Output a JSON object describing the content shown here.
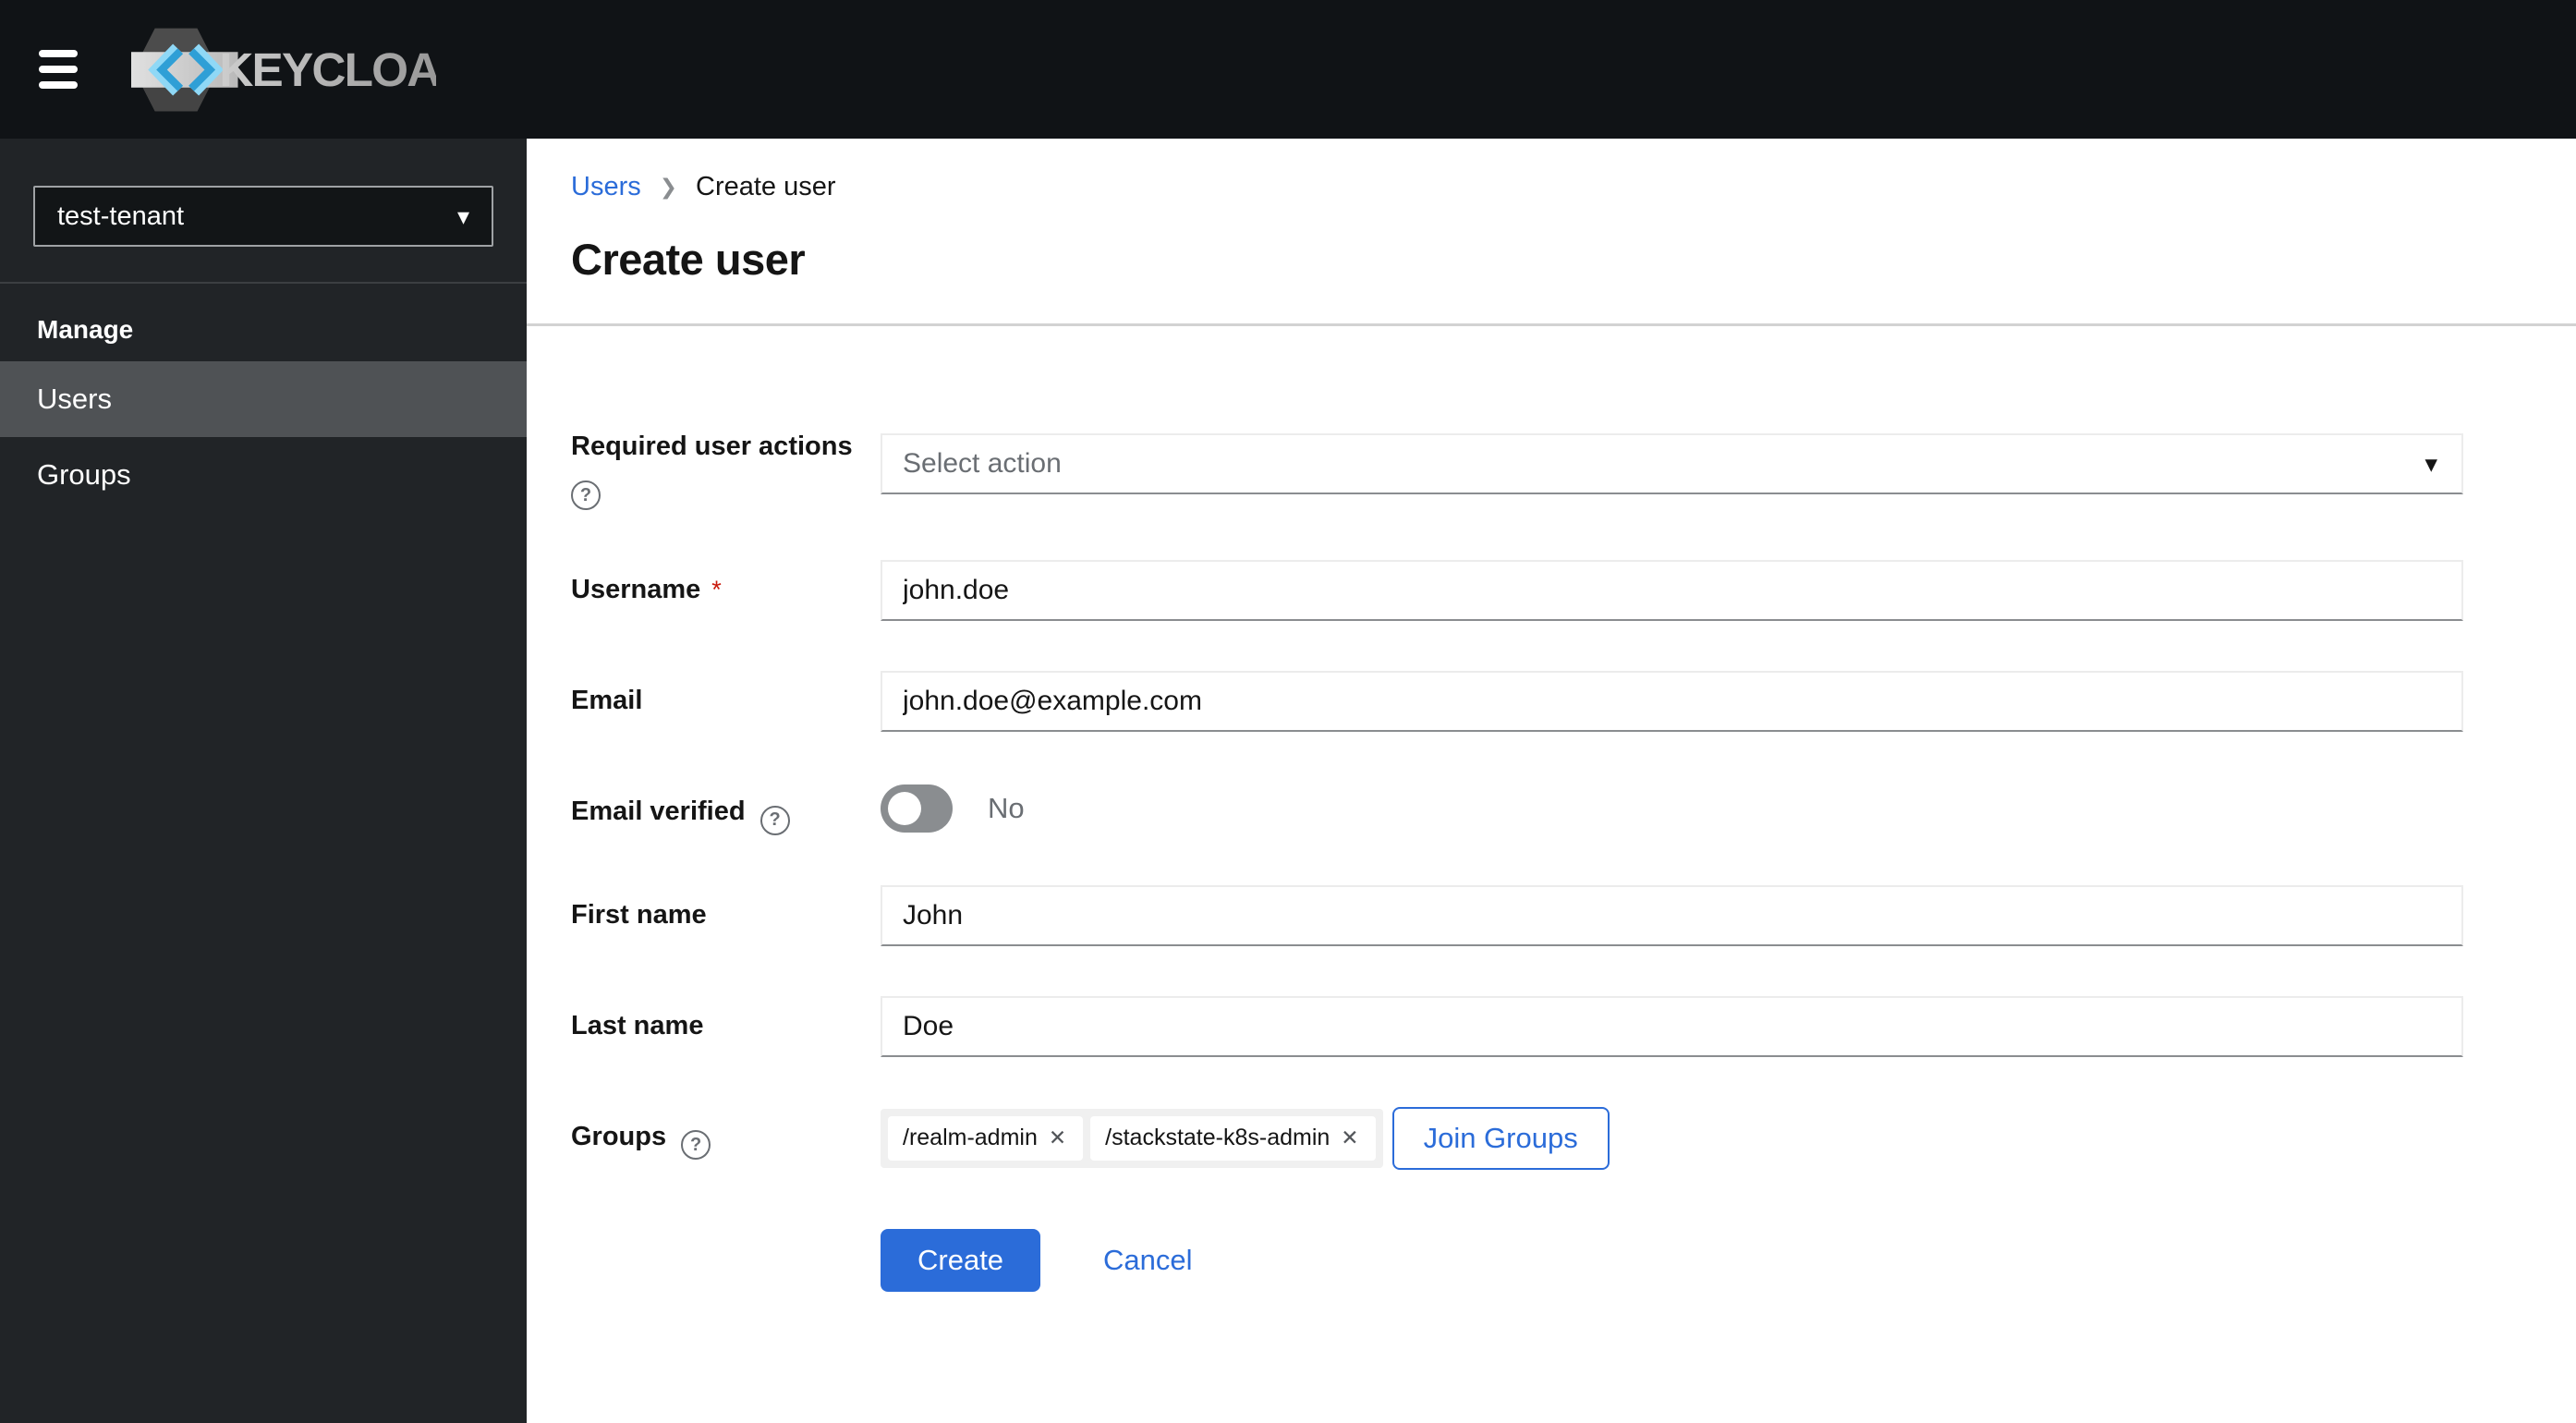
{
  "header": {
    "brand": "KEYCLOAK"
  },
  "sidebar": {
    "realm": "test-tenant",
    "section_title": "Manage",
    "items": [
      {
        "label": "Users"
      },
      {
        "label": "Groups"
      }
    ]
  },
  "breadcrumb": {
    "link": "Users",
    "current": "Create user"
  },
  "page": {
    "title": "Create user"
  },
  "form": {
    "required_actions": {
      "label": "Required user actions",
      "placeholder": "Select action"
    },
    "username": {
      "label": "Username",
      "required_marker": "*",
      "value": "john.doe"
    },
    "email": {
      "label": "Email",
      "value": "john.doe@example.com"
    },
    "email_verified": {
      "label": "Email verified",
      "state_label": "No"
    },
    "first_name": {
      "label": "First name",
      "value": "John"
    },
    "last_name": {
      "label": "Last name",
      "value": "Doe"
    },
    "groups": {
      "label": "Groups",
      "chips": [
        "/realm-admin",
        "/stackstate-k8s-admin"
      ],
      "join_label": "Join Groups"
    },
    "actions": {
      "create": "Create",
      "cancel": "Cancel"
    }
  },
  "icons": {
    "caret_down": "▾",
    "breadcrumb_separator": "❯",
    "help": "?",
    "chip_remove": "✕"
  },
  "colors": {
    "accent": "#2b6cd9",
    "danger": "#c9190b",
    "masthead_bg": "#101316",
    "sidebar_bg": "#212427",
    "sidebar_active_bg": "#4f5255",
    "input_bottom_border": "#8a8d90"
  }
}
